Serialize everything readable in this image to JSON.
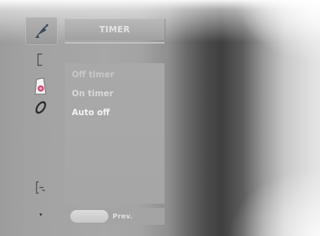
{
  "menu": {
    "title": "TIMER",
    "items": [
      {
        "label": "Off timer"
      },
      {
        "label": "On timer"
      },
      {
        "label": "Auto off"
      }
    ]
  },
  "sidebar": {
    "icons": [
      "satellite-dish-icon",
      "bracket-icon",
      "speaker-icon",
      "tilted-lens-icon",
      "connector-icon",
      "small-arrow-icon"
    ],
    "active_index": 0
  },
  "bottom_hint": {
    "button_label": "",
    "action_label": "Prev."
  }
}
